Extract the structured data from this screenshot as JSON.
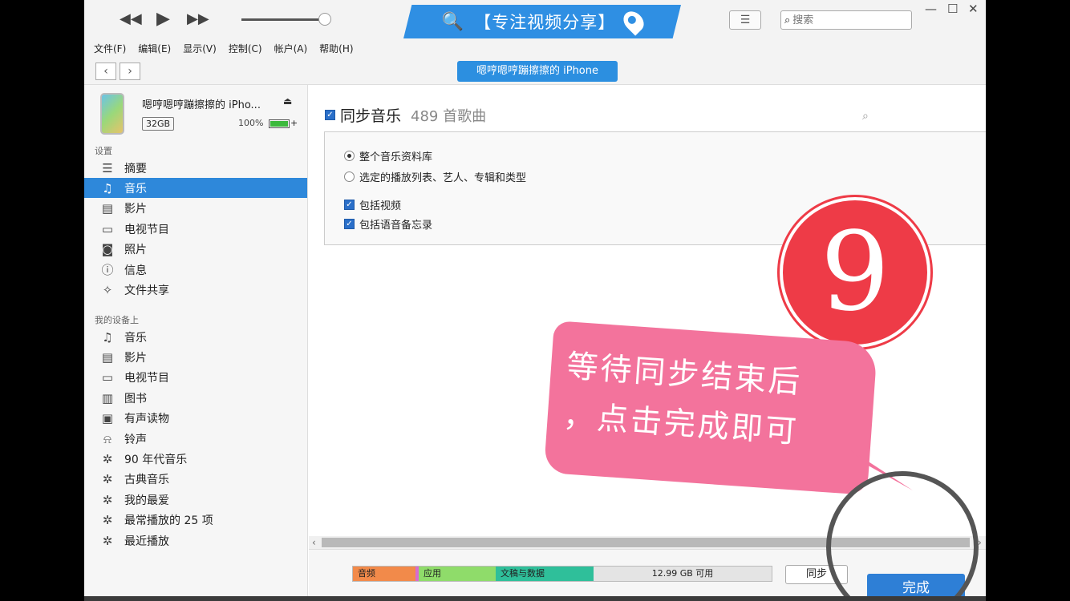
{
  "toolbar": {
    "prev_icon": "rewind-icon",
    "play_icon": "play-icon",
    "next_icon": "fast-forward-icon",
    "search_placeholder": "搜索",
    "banner_text": "【专注视频分享】"
  },
  "menubar": [
    "文件(F)",
    "编辑(E)",
    "显示(V)",
    "控制(C)",
    "帐户(A)",
    "帮助(H)"
  ],
  "nav": {
    "device_pill": "嗯哼嗯哼蹦擦擦的 iPhone"
  },
  "device": {
    "name": "嗯哼嗯哼蹦擦擦的 iPho...",
    "capacity": "32GB",
    "battery_pct": "100%",
    "battery_level": 1.0
  },
  "sidebar": {
    "settings_title": "设置",
    "settings": [
      {
        "label": "摘要",
        "icon": "summary-icon"
      },
      {
        "label": "音乐",
        "icon": "music-note-icon",
        "active": true
      },
      {
        "label": "影片",
        "icon": "film-icon"
      },
      {
        "label": "电视节目",
        "icon": "tv-icon"
      },
      {
        "label": "照片",
        "icon": "camera-icon"
      },
      {
        "label": "信息",
        "icon": "info-icon"
      },
      {
        "label": "文件共享",
        "icon": "file-sharing-icon"
      }
    ],
    "ondevice_title": "我的设备上",
    "ondevice": [
      {
        "label": "音乐",
        "icon": "music-note-icon"
      },
      {
        "label": "影片",
        "icon": "film-icon"
      },
      {
        "label": "电视节目",
        "icon": "tv-icon"
      },
      {
        "label": "图书",
        "icon": "book-icon"
      },
      {
        "label": "有声读物",
        "icon": "audiobook-icon"
      },
      {
        "label": "铃声",
        "icon": "bell-icon"
      },
      {
        "label": "90 年代音乐",
        "icon": "gear-icon"
      },
      {
        "label": "古典音乐",
        "icon": "gear-icon"
      },
      {
        "label": "我的最爱",
        "icon": "gear-icon"
      },
      {
        "label": "最常播放的 25 项",
        "icon": "gear-icon"
      },
      {
        "label": "最近播放",
        "icon": "gear-icon"
      }
    ]
  },
  "main": {
    "sync_title": "同步音乐",
    "sync_count": "489 首歌曲",
    "options": {
      "entire_library": "整个音乐资料库",
      "selected": "选定的播放列表、艺人、专辑和类型",
      "include_videos": "包括视频",
      "include_voice_memos": "包括语音备忘录"
    }
  },
  "footer": {
    "storage": [
      {
        "label": "音频",
        "color": "#f28a4a"
      },
      {
        "label": "应用",
        "color": "#8fdc6a"
      },
      {
        "label": "文稿与数据",
        "color": "#2fbf9a"
      }
    ],
    "free_label": "12.99 GB 可用",
    "sync_button": "同步",
    "done_button": "完成"
  },
  "overlay": {
    "step_number": "9",
    "bubble_line1": "等待同步结束后",
    "bubble_line2": "，点击完成即可",
    "accent_red": "#ee3b47",
    "bubble_pink": "#f3739c"
  }
}
